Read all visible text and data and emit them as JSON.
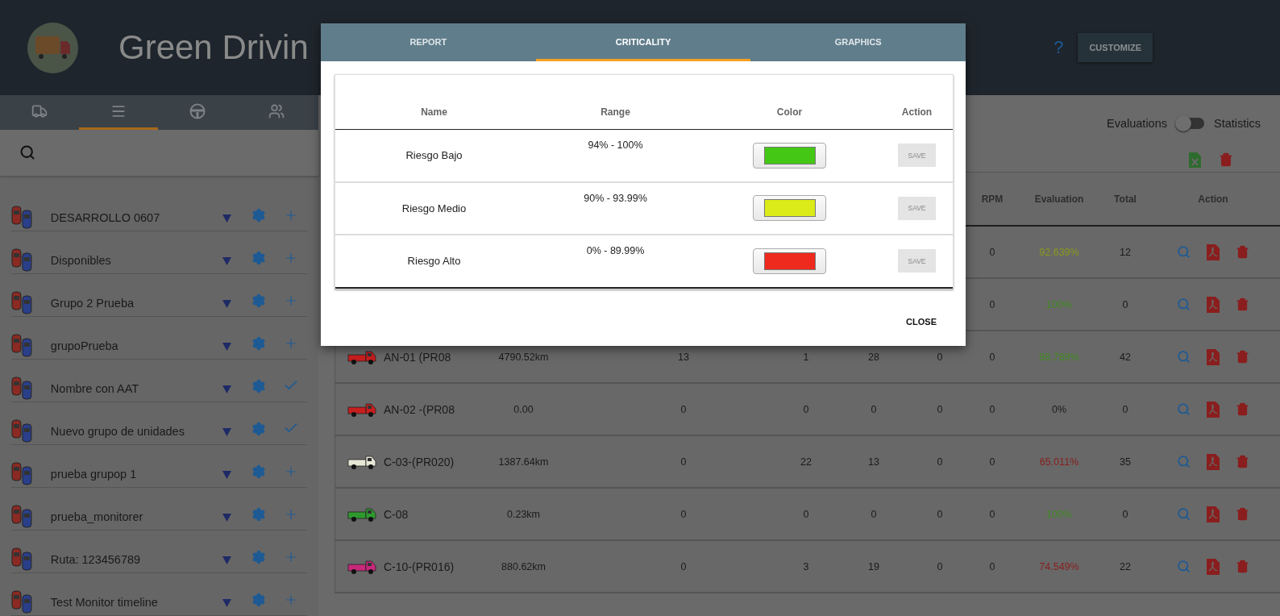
{
  "header": {
    "title": "Green Drivin",
    "help": "?",
    "customize": "CUSTOMIZE"
  },
  "nav_tabs": [
    {
      "kind": "truck",
      "selected": false
    },
    {
      "kind": "list",
      "selected": true
    },
    {
      "kind": "wheel",
      "selected": false
    },
    {
      "kind": "people",
      "selected": false
    }
  ],
  "groups": [
    {
      "name": "DESARROLLO 0607",
      "checked": false
    },
    {
      "name": "Disponibles",
      "checked": false
    },
    {
      "name": "Grupo 2 Prueba",
      "checked": false
    },
    {
      "name": "grupoPrueba",
      "checked": false
    },
    {
      "name": "Nombre con AAT",
      "checked": true
    },
    {
      "name": "Nuevo grupo de unidades",
      "checked": true
    },
    {
      "name": "prueba grupop 1",
      "checked": false
    },
    {
      "name": "prueba_monitorer",
      "checked": false
    },
    {
      "name": "Ruta: 123456789",
      "checked": false
    },
    {
      "name": "Test Monitor timeline",
      "checked": false
    }
  ],
  "toggle": {
    "left": "Evaluations",
    "right": "Statistics",
    "on": false
  },
  "table": {
    "columns": [
      "RPM",
      "Evaluation",
      "Total",
      "Action"
    ],
    "rows": [
      {
        "rpm": "0",
        "evaluation": {
          "value": "92.639%",
          "color": "#8a9a1c"
        },
        "total": "12"
      },
      {
        "rpm": "0",
        "evaluation": {
          "value": "100%",
          "color": "#3f8a1e"
        },
        "total": "0"
      },
      {
        "vehicle": {
          "name": "AN-01 (PR08",
          "color": "#c81e1e"
        },
        "distance": "4790.52km",
        "column_3": "13",
        "column_4": "1",
        "column_5": "28",
        "column_6": "0",
        "rpm": "0",
        "evaluation": {
          "value": "98.789%",
          "color": "#3f8a1e"
        },
        "total": "42"
      },
      {
        "vehicle": {
          "name": "AN-02 -(PR08",
          "color": "#c81e1e"
        },
        "distance": "0.00",
        "column_3": "0",
        "column_4": "0",
        "column_5": "0",
        "column_6": "0",
        "rpm": "0",
        "evaluation": {
          "value": "0%",
          "color": "#1a1a1a"
        },
        "total": "0"
      },
      {
        "vehicle": {
          "name": "C-03-(PR020)",
          "color": "#e8e8d8"
        },
        "distance": "1387.64km",
        "column_3": "0",
        "column_4": "22",
        "column_5": "13",
        "column_6": "0",
        "rpm": "0",
        "evaluation": {
          "value": "65.011%",
          "color": "#8a1e1e"
        },
        "total": "35"
      },
      {
        "vehicle": {
          "name": "C-08",
          "color": "#2e9a2e"
        },
        "distance": "0.23km",
        "column_3": "0",
        "column_4": "0",
        "column_5": "0",
        "column_6": "0",
        "rpm": "0",
        "evaluation": {
          "value": "100%",
          "color": "#3f8a1e"
        },
        "total": "0"
      },
      {
        "vehicle": {
          "name": "C-10-(PR016)",
          "color": "#c8287a"
        },
        "distance": "880.62km",
        "column_3": "0",
        "column_4": "3",
        "column_5": "19",
        "column_6": "0",
        "rpm": "0",
        "evaluation": {
          "value": "74.549%",
          "color": "#8a1e1e"
        },
        "total": "22"
      }
    ]
  },
  "dialog": {
    "tabs": [
      {
        "label": "REPORT",
        "selected": false
      },
      {
        "label": "CRITICALITY",
        "selected": true
      },
      {
        "label": "GRAPHICS",
        "selected": false
      }
    ],
    "columns": [
      "Name",
      "Range",
      "Color",
      "Action"
    ],
    "rows": [
      {
        "name": "Riesgo Bajo",
        "range": "94%  -  100%",
        "color": "#44c815",
        "action": "SAVE"
      },
      {
        "name": "Riesgo Medio",
        "range": "90%  -  93.99%",
        "color": "#dbeb19",
        "action": "SAVE"
      },
      {
        "name": "Riesgo Alto",
        "range": "0%  -  89.99%",
        "color": "#ee2a1e",
        "action": "SAVE"
      }
    ],
    "close": "CLOSE"
  }
}
